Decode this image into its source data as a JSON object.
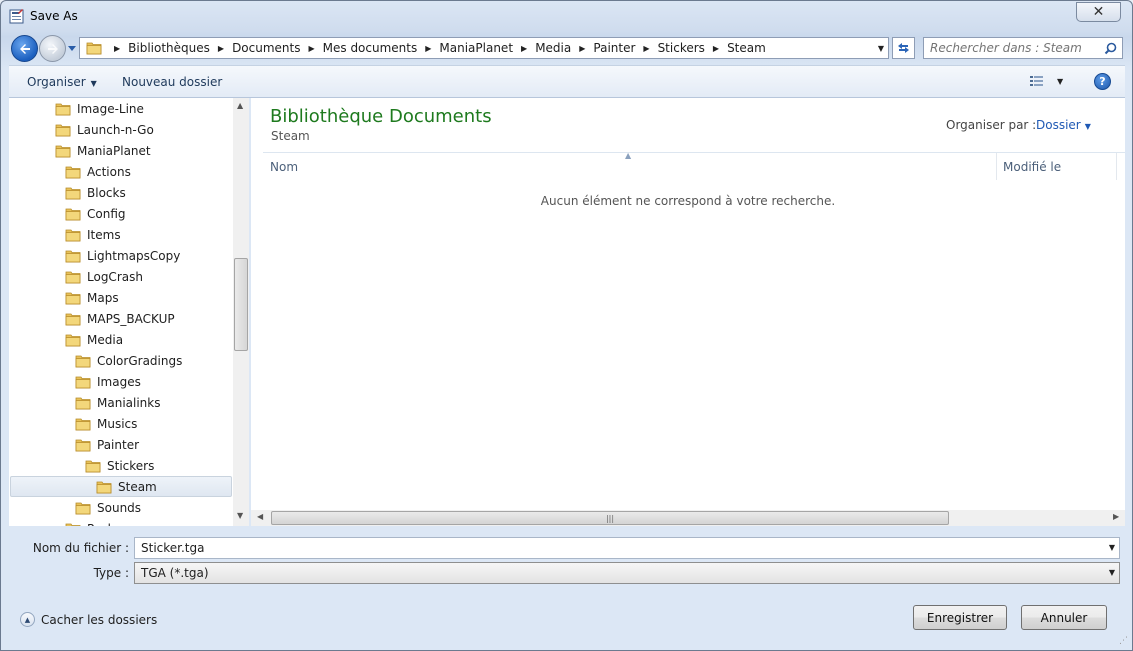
{
  "window": {
    "title": "Save As"
  },
  "address": {
    "crumbs": [
      "Bibliothèques",
      "Documents",
      "Mes documents",
      "ManiaPlanet",
      "Media",
      "Painter",
      "Stickers",
      "Steam"
    ]
  },
  "search": {
    "placeholder": "Rechercher dans : Steam"
  },
  "toolbar": {
    "organize_label": "Organiser",
    "new_folder_label": "Nouveau dossier"
  },
  "tree": {
    "items": [
      {
        "label": "Image-Line",
        "level": 0
      },
      {
        "label": "Launch-n-Go",
        "level": 0
      },
      {
        "label": "ManiaPlanet",
        "level": 0
      },
      {
        "label": "Actions",
        "level": 1
      },
      {
        "label": "Blocks",
        "level": 1
      },
      {
        "label": "Config",
        "level": 1
      },
      {
        "label": "Items",
        "level": 1
      },
      {
        "label": "LightmapsCopy",
        "level": 1
      },
      {
        "label": "LogCrash",
        "level": 1
      },
      {
        "label": "Maps",
        "level": 1
      },
      {
        "label": "MAPS_BACKUP",
        "level": 1
      },
      {
        "label": "Media",
        "level": 1
      },
      {
        "label": "ColorGradings",
        "level": 2
      },
      {
        "label": "Images",
        "level": 2
      },
      {
        "label": "Manialinks",
        "level": 2
      },
      {
        "label": "Musics",
        "level": 2
      },
      {
        "label": "Painter",
        "level": 2
      },
      {
        "label": "Stickers",
        "level": 3
      },
      {
        "label": "Steam",
        "level": 4,
        "selected": true
      },
      {
        "label": "Sounds",
        "level": 2
      },
      {
        "label": "Packs",
        "level": 1
      }
    ]
  },
  "content": {
    "library_title": "Bibliothèque Documents",
    "library_subtitle": "Steam",
    "arrange_label": "Organiser par :",
    "arrange_value": "Dossier",
    "columns": {
      "name": "Nom",
      "modified": "Modifié le"
    },
    "empty_message": "Aucun élément ne correspond à votre recherche."
  },
  "form": {
    "filename_label": "Nom du fichier :",
    "filename_value": "Sticker.tga",
    "type_label": "Type :",
    "type_value": "TGA (*.tga)"
  },
  "footer": {
    "hide_folders_label": "Cacher les dossiers",
    "save_label": "Enregistrer",
    "cancel_label": "Annuler"
  },
  "colors": {
    "library_title": "#1e7a1e",
    "link_blue": "#1f59b4",
    "folder_yellow": "#e8c25a"
  }
}
